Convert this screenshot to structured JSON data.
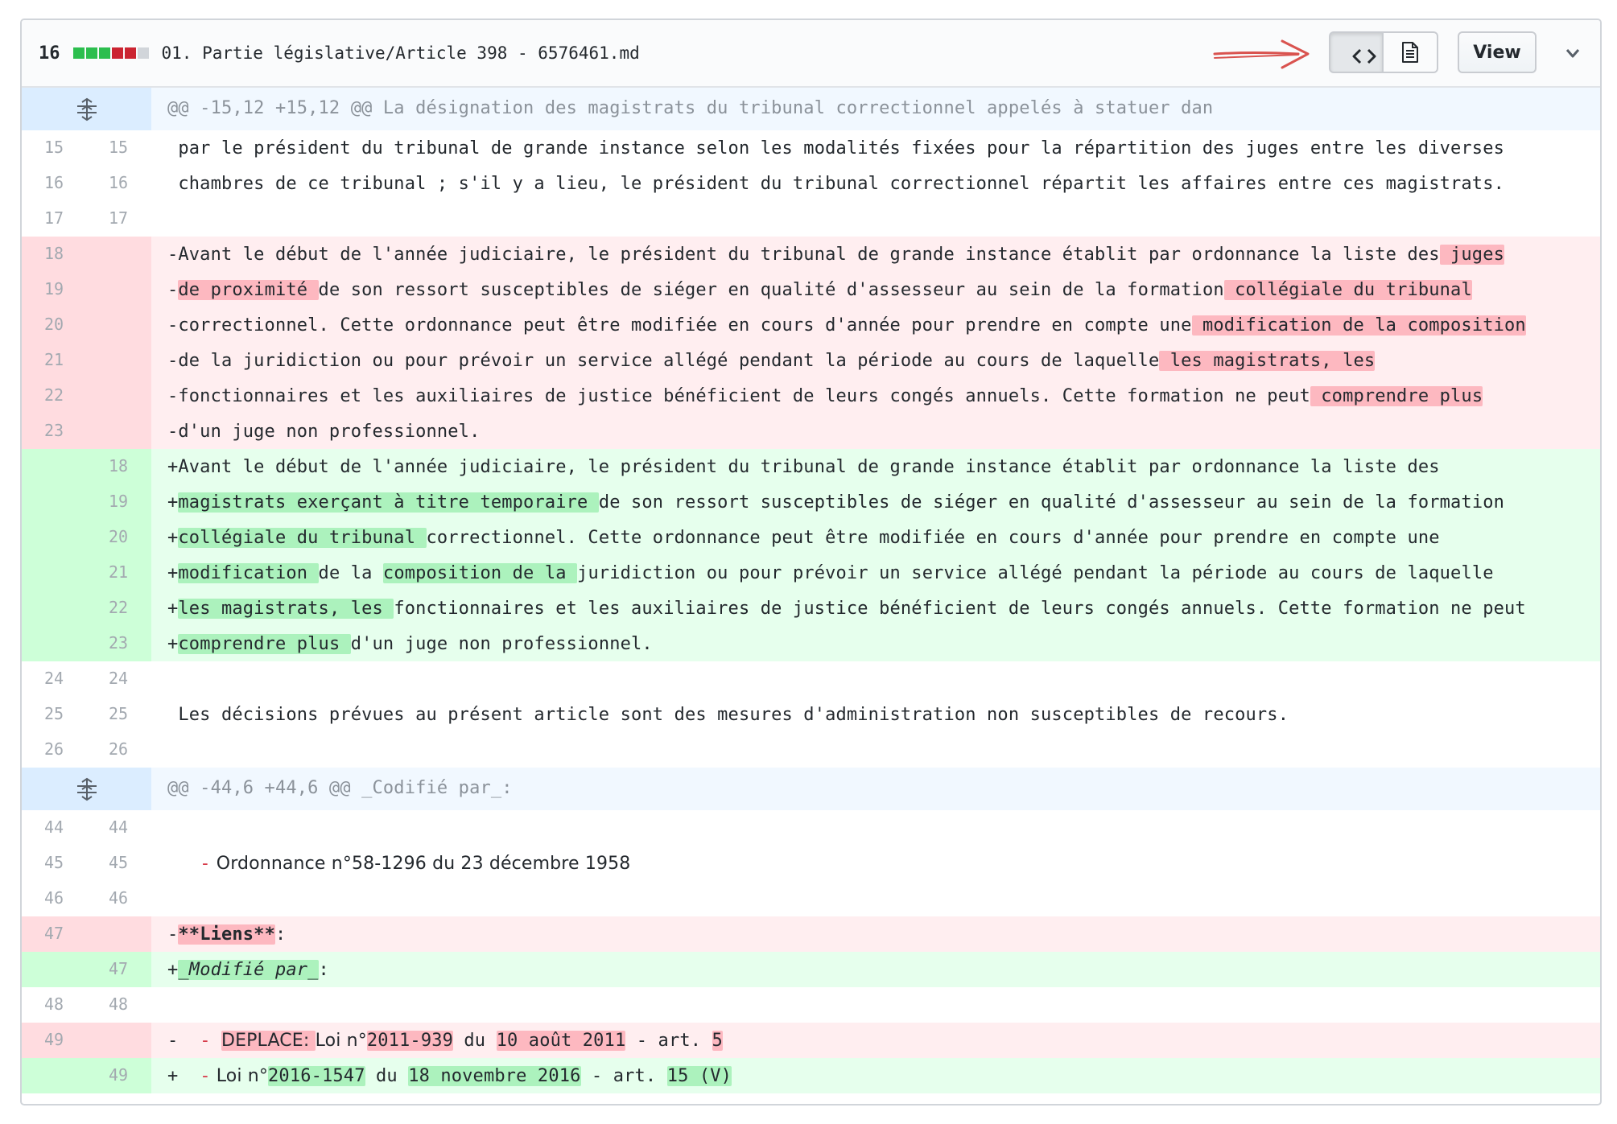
{
  "file": {
    "change_count": "16",
    "diffstat_colors": [
      "#2cbe4e",
      "#2cbe4e",
      "#2cbe4e",
      "#cb2431",
      "#cb2431",
      "#d1d5da"
    ],
    "name": "01. Partie législative/Article 398 - 6576461.md",
    "view_label": "View",
    "icons": [
      "arrow-right-icon",
      "code-icon",
      "file-text-icon",
      "chevron-down-icon",
      "expand-icon"
    ]
  },
  "hunk1": {
    "header": "@@ -15,12 +15,12 @@ La désignation des magistrats du tribunal correctionnel appelés à statuer dan",
    "ctx15": {
      "o": "15",
      "n": "15",
      "t": " par le président du tribunal de grande instance selon les modalités fixées pour la répartition des juges entre les diverses"
    },
    "ctx16": {
      "o": "16",
      "n": "16",
      "t": " chambres de ce tribunal ; s'il y a lieu, le président du tribunal correctionnel répartit les affaires entre ces magistrats."
    },
    "ctx17": {
      "o": "17",
      "n": "17"
    },
    "del18": {
      "o": "18",
      "a": "-Avant le début de l'année judiciaire, le président du tribunal de grande instance établit par ordonnance la liste des",
      "b": " juges"
    },
    "del19": {
      "o": "19",
      "a": "-",
      "b": "de proximité ",
      "c": "de son ressort susceptibles de siéger en qualité d'assesseur au sein de la formation",
      "d": " collégiale du tribunal"
    },
    "del20": {
      "o": "20",
      "a": "-correctionnel. Cette ordonnance peut être modifiée en cours d'année pour prendre en compte une",
      "b": " modification de la composition"
    },
    "del21": {
      "o": "21",
      "a": "-de la juridiction ou pour prévoir un service allégé pendant la période au cours de laquelle",
      "b": " les magistrats, les"
    },
    "del22": {
      "o": "22",
      "a": "-fonctionnaires et les auxiliaires de justice bénéficient de leurs congés annuels. Cette formation ne peut",
      "b": " comprendre plus"
    },
    "del23": {
      "o": "23",
      "a": "-d'un juge non professionnel."
    },
    "add18": {
      "n": "18",
      "a": "+Avant le début de l'année judiciaire, le président du tribunal de grande instance établit par ordonnance la liste des"
    },
    "add19": {
      "n": "19",
      "a": "+",
      "b": "magistrats exerçant à titre temporaire ",
      "c": "de son ressort susceptibles de siéger en qualité d'assesseur au sein de la formation"
    },
    "add20": {
      "n": "20",
      "a": "+",
      "b": "collégiale du tribunal ",
      "c": "correctionnel. Cette ordonnance peut être modifiée en cours d'année pour prendre en compte une"
    },
    "add21": {
      "n": "21",
      "a": "+",
      "b": "modification ",
      "c": "de la ",
      "d": "composition de la ",
      "e": "juridiction ou pour prévoir un service allégé pendant la période au cours de laquelle"
    },
    "add22": {
      "n": "22",
      "a": "+",
      "b": "les magistrats, les ",
      "c": "fonctionnaires et les auxiliaires de justice bénéficient de leurs congés annuels. Cette formation ne peut"
    },
    "add23": {
      "n": "23",
      "a": "+",
      "b": "comprendre plus ",
      "c": "d'un juge non professionnel."
    },
    "ctx24": {
      "o": "24",
      "n": "24"
    },
    "ctx25": {
      "o": "25",
      "n": "25",
      "t": " Les décisions prévues au présent article sont des mesures d'administration non susceptibles de recours."
    },
    "ctx26": {
      "o": "26",
      "n": "26"
    }
  },
  "hunk2": {
    "header": "@@ -44,6 +44,6 @@ _Codifié par_:",
    "ctx44": {
      "o": "44",
      "n": "44"
    },
    "ctx45": {
      "o": "45",
      "n": "45",
      "a": "   ",
      "dash": "-",
      "t": " Ordonnance n°58-1296 du 23 décembre 1958"
    },
    "ctx46": {
      "o": "46",
      "n": "46"
    },
    "del47": {
      "o": "47",
      "a": "-",
      "b": "**Liens**",
      "c": ":"
    },
    "add47": {
      "n": "47",
      "a": "+",
      "b": "_Modifié par_",
      "c": ":"
    },
    "ctx48": {
      "o": "48",
      "n": "48"
    },
    "del49": {
      "o": "49",
      "a": "-  ",
      "dash": "-",
      "sp": " ",
      "b": "DEPLACE: ",
      "c": "Loi n°",
      "d": "2011-939",
      "e": " du ",
      "f": "10 août 2011",
      "g": " - art. ",
      "h": "5"
    },
    "add49": {
      "n": "49",
      "a": "+  ",
      "dash": "-",
      "c": " Loi n°",
      "d": "2016-1547",
      "e": " du ",
      "f": "18 novembre 2016",
      "g": " - art. ",
      "h": "15 (V)"
    }
  }
}
